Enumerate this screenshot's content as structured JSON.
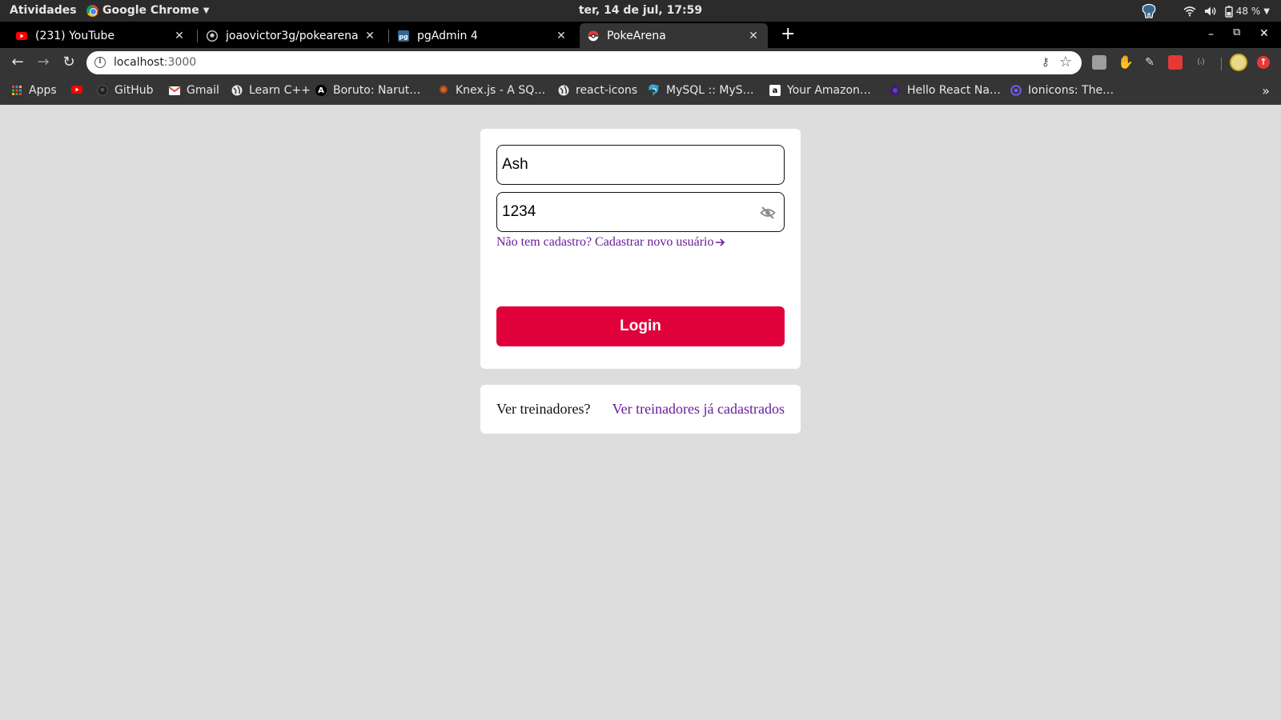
{
  "system_bar": {
    "activities": "Atividades",
    "app_name": "Google Chrome",
    "clock": "ter, 14 de jul, 17:59",
    "battery": "48 %"
  },
  "tabs": [
    {
      "title": "(231) YouTube",
      "icon": "youtube-icon"
    },
    {
      "title": "joaovictor3g/pokearena",
      "icon": "github-icon"
    },
    {
      "title": "pgAdmin 4",
      "icon": "pgadmin-icon"
    },
    {
      "title": "PokeArena",
      "icon": "pokeball-icon",
      "active": true
    }
  ],
  "address_bar": {
    "host": "localhost",
    "port": ":3000"
  },
  "bookmarks": [
    {
      "label": "Apps",
      "icon": "apps-grid-icon"
    },
    {
      "label": "",
      "icon": "youtube-icon"
    },
    {
      "label": "GitHub",
      "icon": "github-icon"
    },
    {
      "label": "Gmail",
      "icon": "gmail-icon"
    },
    {
      "label": "Learn C++",
      "icon": "globe-icon"
    },
    {
      "label": "Boruto: Narut…",
      "icon": "a-letter-icon"
    },
    {
      "label": "Knex.js - A SQ…",
      "icon": "knex-icon"
    },
    {
      "label": "react-icons",
      "icon": "globe-icon"
    },
    {
      "label": "MySQL :: MyS…",
      "icon": "mysql-icon"
    },
    {
      "label": "Your Amazon…",
      "icon": "amazon-icon"
    },
    {
      "label": "Hello React Na…",
      "icon": "react-native-icon"
    },
    {
      "label": "Ionicons: The…",
      "icon": "ionicons-icon"
    }
  ],
  "login_form": {
    "username_value": "Ash",
    "password_value": "1234",
    "signup_link": "Não tem cadastro? Cadastrar novo usuário",
    "login_button": "Login"
  },
  "trainers_card": {
    "question": "Ver treinadores?",
    "link": "Ver treinadores já cadastrados"
  },
  "colors": {
    "login_button": "#e0003a",
    "link": "#6a1b9a",
    "page_background": "#dddddd"
  }
}
